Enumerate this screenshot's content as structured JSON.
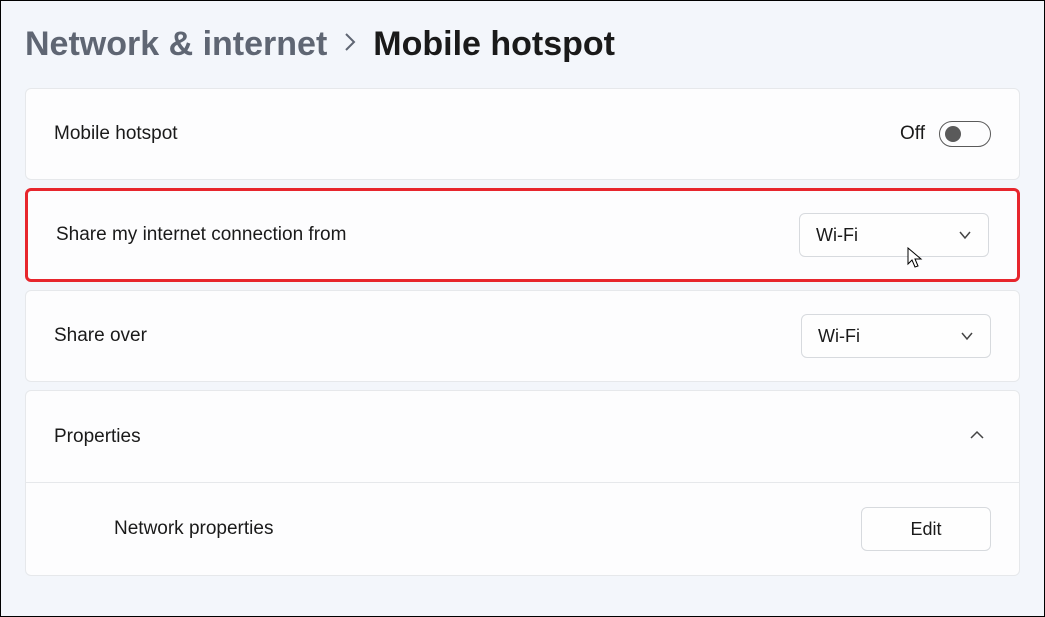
{
  "breadcrumb": {
    "parent": "Network & internet",
    "current": "Mobile hotspot"
  },
  "hotspot_row": {
    "label": "Mobile hotspot",
    "toggle_state_text": "Off"
  },
  "share_from_row": {
    "label": "Share my internet connection from",
    "selected": "Wi-Fi"
  },
  "share_over_row": {
    "label": "Share over",
    "selected": "Wi-Fi"
  },
  "properties": {
    "header": "Properties",
    "network_props_label": "Network properties",
    "edit_button": "Edit"
  }
}
